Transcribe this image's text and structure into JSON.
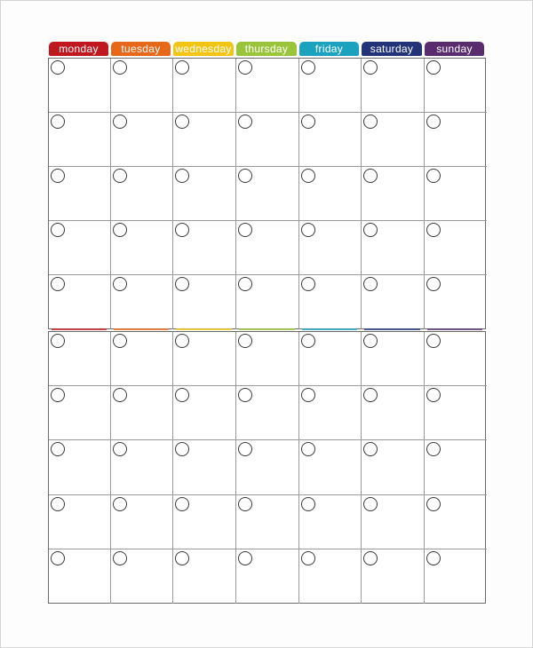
{
  "calendar": {
    "days": [
      {
        "label": "monday",
        "color": "#c0181f"
      },
      {
        "label": "tuesday",
        "color": "#e8681a"
      },
      {
        "label": "wednesday",
        "color": "#f2c515"
      },
      {
        "label": "thursday",
        "color": "#9ac43a"
      },
      {
        "label": "friday",
        "color": "#1aa2bf"
      },
      {
        "label": "saturday",
        "color": "#22337a"
      },
      {
        "label": "sunday",
        "color": "#5a2c6e"
      }
    ],
    "blocks": [
      {
        "name": "top",
        "rows": 5
      },
      {
        "name": "bottom",
        "rows": 5
      }
    ]
  }
}
